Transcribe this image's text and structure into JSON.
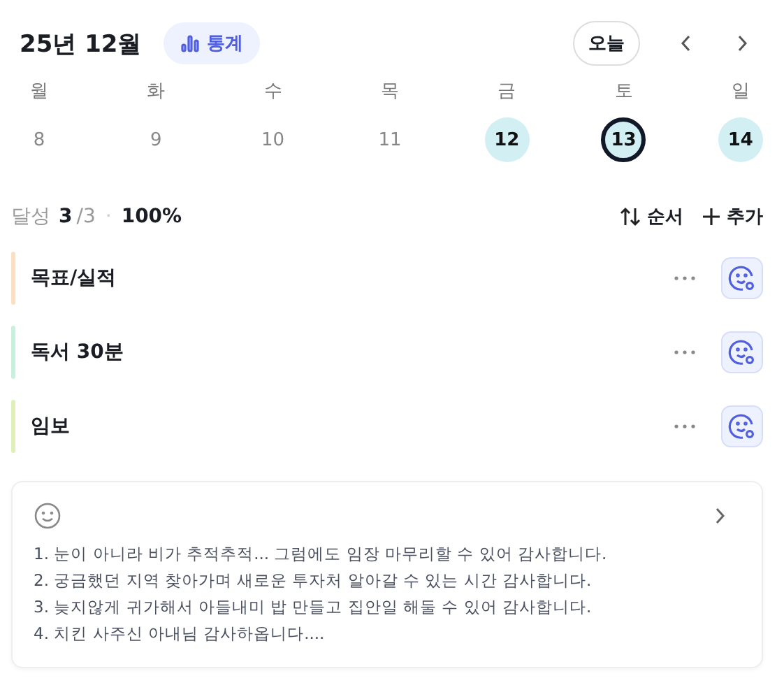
{
  "header": {
    "month": "25년 12월",
    "stats_button": "통계",
    "today_button": "오늘"
  },
  "days": [
    {
      "weekday": "월",
      "day": "8",
      "done": false,
      "selected": false
    },
    {
      "weekday": "화",
      "day": "9",
      "done": false,
      "selected": false
    },
    {
      "weekday": "수",
      "day": "10",
      "done": false,
      "selected": false
    },
    {
      "weekday": "목",
      "day": "11",
      "done": false,
      "selected": false
    },
    {
      "weekday": "금",
      "day": "12",
      "done": true,
      "selected": false
    },
    {
      "weekday": "토",
      "day": "13",
      "done": true,
      "selected": true
    },
    {
      "weekday": "일",
      "day": "14",
      "done": true,
      "selected": false
    }
  ],
  "summary": {
    "label": "달성",
    "done": "3",
    "total": "/3",
    "separator": "·",
    "percent": "100%",
    "sort_button": "순서",
    "add_button": "추가"
  },
  "goals": [
    {
      "title": "목표/실적",
      "color": "#fbe0c3"
    },
    {
      "title": "독서 30분",
      "color": "#c9f0dc"
    },
    {
      "title": "임보",
      "color": "#dff0b8"
    }
  ],
  "journal": {
    "lines": [
      "1. 눈이 아니라 비가 추적추적... 그럼에도 임장 마무리할 수 있어 감사합니다.",
      "2. 궁금했던 지역 찾아가며 새로운 투자처 알아갈 수 있는 시간 감사합니다.",
      "3. 늦지않게 귀가해서 아들내미 밥 만들고 집안일 해둘 수 있어 감사합니다.",
      "4. 치킨 사주신 아내님 감사하옵니다...."
    ]
  }
}
